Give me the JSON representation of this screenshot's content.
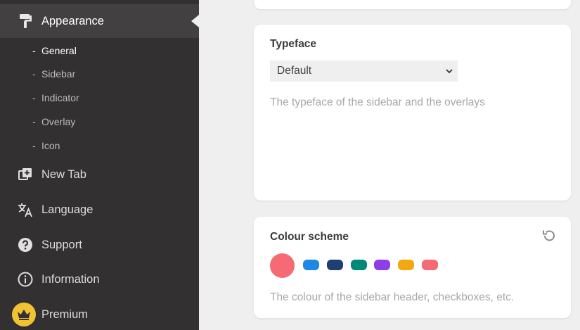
{
  "sidebar": {
    "appearance_label": "Appearance",
    "sub_items": [
      "General",
      "Sidebar",
      "Indicator",
      "Overlay",
      "Icon"
    ],
    "new_tab_label": "New Tab",
    "language_label": "Language",
    "support_label": "Support",
    "information_label": "Information",
    "premium_label": "Premium"
  },
  "typeface": {
    "title": "Typeface",
    "selected": "Default",
    "description": "The typeface of the sidebar and the overlays"
  },
  "colour_scheme": {
    "title": "Colour scheme",
    "description": "The colour of the sidebar header, checkboxes, etc.",
    "colors": [
      "#f66a74",
      "#1e88e5",
      "#1e3f72",
      "#00897b",
      "#8e3ee6",
      "#f3a712",
      "#f66a74"
    ]
  }
}
